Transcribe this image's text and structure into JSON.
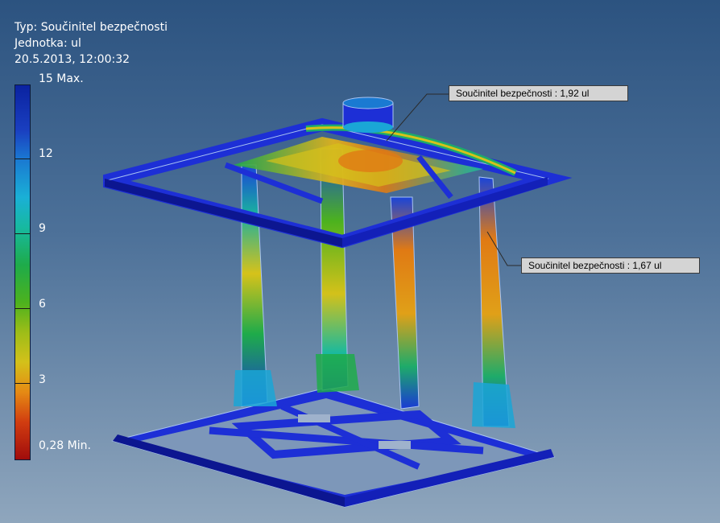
{
  "info": {
    "type_line": "Typ: Součinitel bezpečnosti",
    "unit_line": "Jednotka: ul",
    "date_line": "20.5.2013, 12:00:32"
  },
  "legend": {
    "max_label": "15 Max.",
    "min_label": "0,28 Min.",
    "tick_labels": [
      "12",
      "9",
      "6",
      "3"
    ],
    "colors": [
      "#0a22a0",
      "#1a4fd0",
      "#1aa6d6",
      "#17b9a0",
      "#1eab4a",
      "#72b81a",
      "#cfc11a",
      "#e06a12",
      "#b01010"
    ]
  },
  "callouts": [
    {
      "text": "Součinitel bezpečnosti : 1,92 ul"
    },
    {
      "text": "Součinitel bezpečnosti : 1,67 ul"
    }
  ],
  "colors": {
    "frame_blue": "#1d2fd6",
    "frame_dark": "#0c1690",
    "edge_light": "#a9c4f2"
  }
}
